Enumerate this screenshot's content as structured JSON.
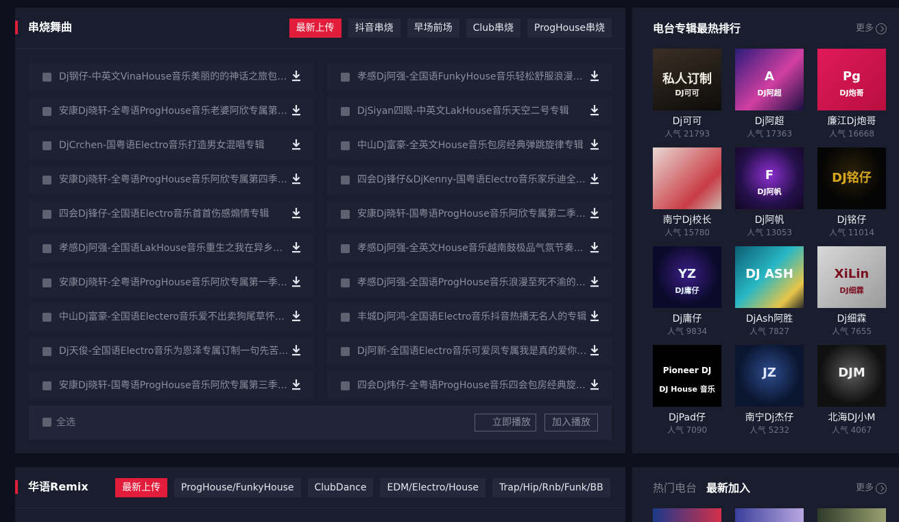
{
  "section1": {
    "title": "串烧舞曲",
    "tabs": [
      "最新上传",
      "抖音串烧",
      "早场前场",
      "Club串烧",
      "ProgHouse串烧"
    ],
    "songs_left": [
      "Dj钢仔-中英文VinaHouse音乐美丽的的神话之旅包房专辑",
      "安康Dj晓轩-全粤语ProgHouse音乐老婆阿欣专属第五季",
      "DjCrchen-国粤语Electro音乐打造男女混唱专辑",
      "安康Dj晓轩-全粤语ProgHouse音乐阿欣专属第四季专辑",
      "四会Dj锋仔-全国语Electro音乐首首伤感煽情专辑",
      "孝感Dj阿强-全国语LakHouse音乐重生之我在异乡为异客",
      "安康Dj晓轩-全粤语ProgHouse音乐阿欣专属第一季专辑",
      "中山Dj富豪-全国语Electero音乐爱不出卖狗尾草怀旧专辑",
      "Dj天俊-全国语Electro音乐为恩泽专属订制一句先苦后甜",
      "安康Dj晓轩-国粤语ProgHouse音乐阿欣专属第三季专辑"
    ],
    "songs_right": [
      "孝感Dj阿强-全国语FunkyHouse音乐轻松舒服浪漫情歌专辑",
      "DjSiyan四眼-中英文LakHouse音乐天空二号专辑",
      "中山Dj富豪-全英文House音乐包房经典弹跳旋律专辑",
      "四会Dj锋仔&DjKenny-国粤语Electro音乐家乐迪全场专辑",
      "安康Dj晓轩-国粤语ProgHouse音乐阿欣专属第二季专辑",
      "孝感Dj阿强-全英文House音乐越南鼓极品气氛节奏专辑",
      "孝感Dj阿强-全国语ProgHouse音乐浪漫至死不渝的爱情",
      "丰城Dj阿鸿-全国语Electro音乐抖音热播无名人的专辑",
      "Dj阿新-全国语Electro音乐可爱凤专属我是真的爱你专辑",
      "四会Dj炜仔-全粤语ProgHouse音乐四会包房经典旋律专辑"
    ],
    "select_all": "全选",
    "play_button": "立即播放",
    "add_button": "加入播放"
  },
  "ranking": {
    "title": "电台专辑最热排行",
    "more": "更多",
    "djs": [
      {
        "name": "Dj可可",
        "pop": "人气 21793",
        "cover_text": "私人订制",
        "cover_sub": "DJ可可"
      },
      {
        "name": "Dj阿超",
        "pop": "人气 17363",
        "cover_text": "A",
        "cover_sub": "DJ阿超"
      },
      {
        "name": "廉江Dj炮哥",
        "pop": "人气 16668",
        "cover_text": "Pg",
        "cover_sub": "DJ炮哥"
      },
      {
        "name": "南宁Dj校长",
        "pop": "人气 15780",
        "cover_text": "",
        "cover_sub": ""
      },
      {
        "name": "Dj阿帆",
        "pop": "人气 13053",
        "cover_text": "F",
        "cover_sub": "DJ阿帆"
      },
      {
        "name": "Dj铭仔",
        "pop": "人气 11014",
        "cover_text": "DJ铭仔",
        "cover_sub": ""
      },
      {
        "name": "Dj庸仔",
        "pop": "人气 9834",
        "cover_text": "YZ",
        "cover_sub": "DJ庸仔"
      },
      {
        "name": "DjAsh阿胜",
        "pop": "人气 7827",
        "cover_text": "DJ ASH",
        "cover_sub": ""
      },
      {
        "name": "Dj细霖",
        "pop": "人气 7655",
        "cover_text": "XiLin",
        "cover_sub": "DJ细霖"
      },
      {
        "name": "DjPad仔",
        "pop": "人气 7090",
        "cover_text": "Pioneer DJ",
        "cover_sub": "DJ House 音乐"
      },
      {
        "name": "南宁Dj杰仔",
        "pop": "人气 5232",
        "cover_text": "JZ",
        "cover_sub": ""
      },
      {
        "name": "北海DJ小M",
        "pop": "人气 4067",
        "cover_text": "DJM",
        "cover_sub": ""
      }
    ]
  },
  "section2": {
    "title": "华语Remix",
    "tabs": [
      "最新上传",
      "ProgHouse/FunkyHouse",
      "ClubDance",
      "EDM/Electro/House",
      "Trap/Hip/Rnb/Funk/BB"
    ]
  },
  "radio": {
    "tab_hot": "热门电台",
    "tab_new": "最新加入",
    "more": "更多"
  },
  "colors": {
    "accent": "#e21d3b",
    "panel": "#191d2e",
    "background": "#0e111d"
  }
}
